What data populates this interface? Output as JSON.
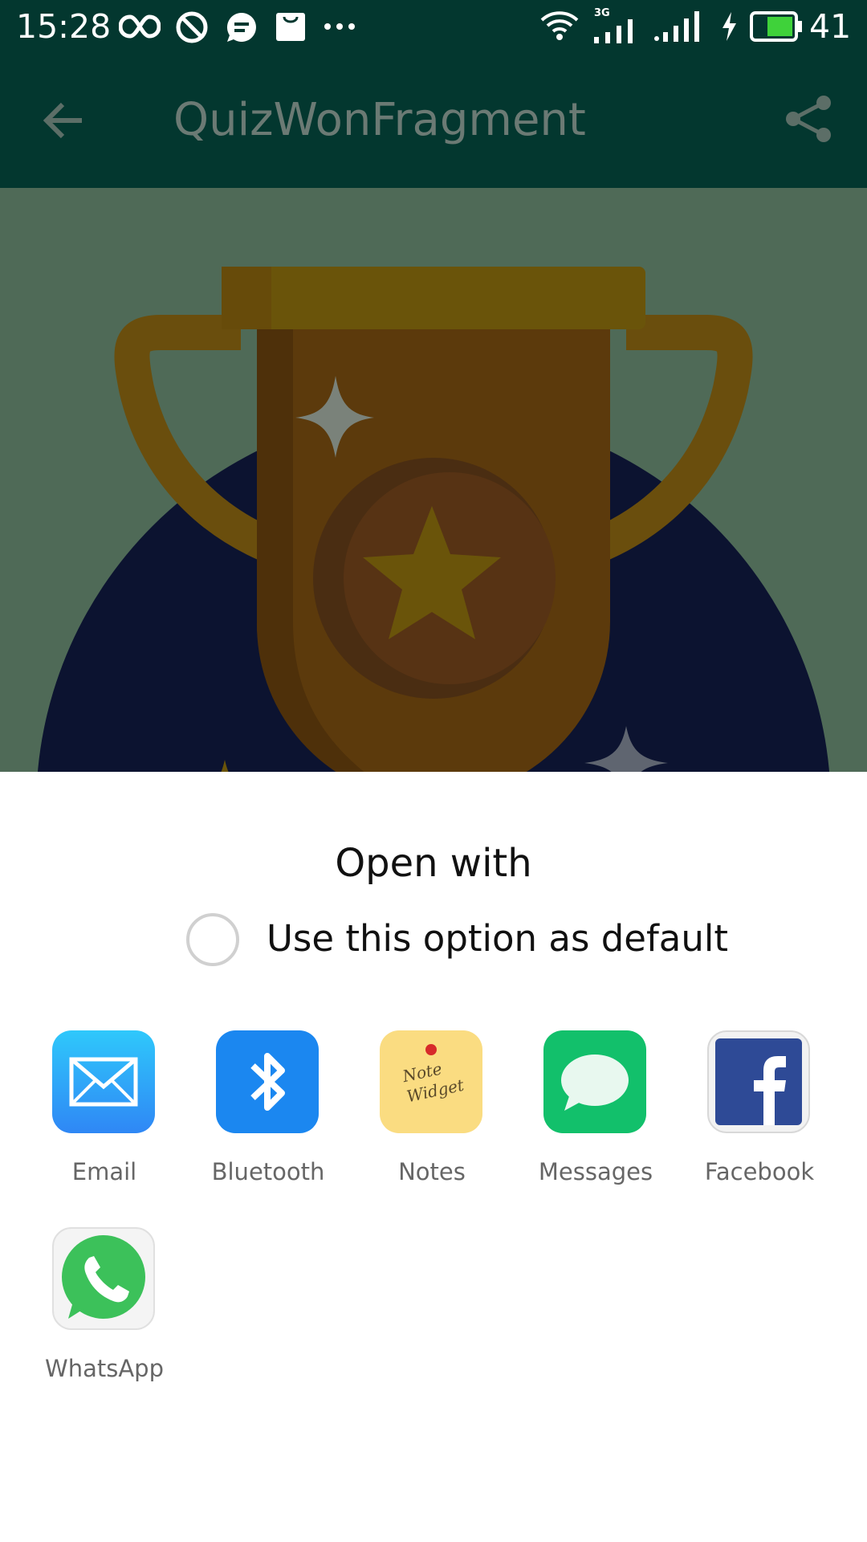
{
  "status_bar": {
    "time": "15:28",
    "network_label": "3G",
    "battery": "41",
    "icons": [
      "infinity-icon",
      "do-not-disturb-icon",
      "chat-bubble-icon",
      "shopping-bag-icon",
      "more-dots-icon",
      "wifi-icon",
      "signal-3g-icon",
      "signal-icon",
      "charging-bolt-icon",
      "battery-icon"
    ]
  },
  "app_bar": {
    "title": "QuizWonFragment",
    "back_icon": "arrow-back-icon",
    "share_icon": "share-icon"
  },
  "hero": {
    "image": "trophy-illustration"
  },
  "sheet": {
    "title": "Open with",
    "default_option": {
      "label": "Use this option as default",
      "checked": false
    },
    "apps": [
      {
        "label": "Email",
        "icon": "envelope-icon",
        "color": "#2f9bf7"
      },
      {
        "label": "Bluetooth",
        "icon": "bluetooth-icon",
        "color": "#1b87f0"
      },
      {
        "label": "Notes",
        "icon": "note-widget-icon",
        "color": "#fadc81",
        "icon_text_1": "Note",
        "icon_text_2": "Widget"
      },
      {
        "label": "Messages",
        "icon": "speech-bubble-icon",
        "color": "#12c06b"
      },
      {
        "label": "Facebook",
        "icon": "facebook-icon",
        "color": "#2e4a96"
      },
      {
        "label": "WhatsApp",
        "icon": "whatsapp-icon",
        "color": "#3cc15a"
      }
    ]
  },
  "colors": {
    "app_bar": "#03372f",
    "scrim_bg": "#4f6a57",
    "circle": "#0c1330",
    "trophy": "#6a4a0e"
  }
}
